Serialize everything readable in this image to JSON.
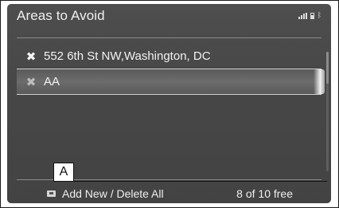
{
  "header": {
    "title": "Areas to Avoid"
  },
  "status_icons": [
    "signal-icon",
    "battery-icon",
    "bluetooth-icon"
  ],
  "avoid_list": [
    {
      "icon": "avoid-area-icon",
      "label": "552 6th St NW,Washington, DC"
    },
    {
      "icon": "avoid-area-icon",
      "label": "AA"
    }
  ],
  "footer": {
    "add_delete_label": "Add New / Delete All",
    "free_count": "8 of 10 free"
  },
  "callout": {
    "label": "A"
  },
  "colors": {
    "screen_bg": "#474747",
    "text": "#f2f2f2",
    "selected_row": "#6c6c6c"
  }
}
